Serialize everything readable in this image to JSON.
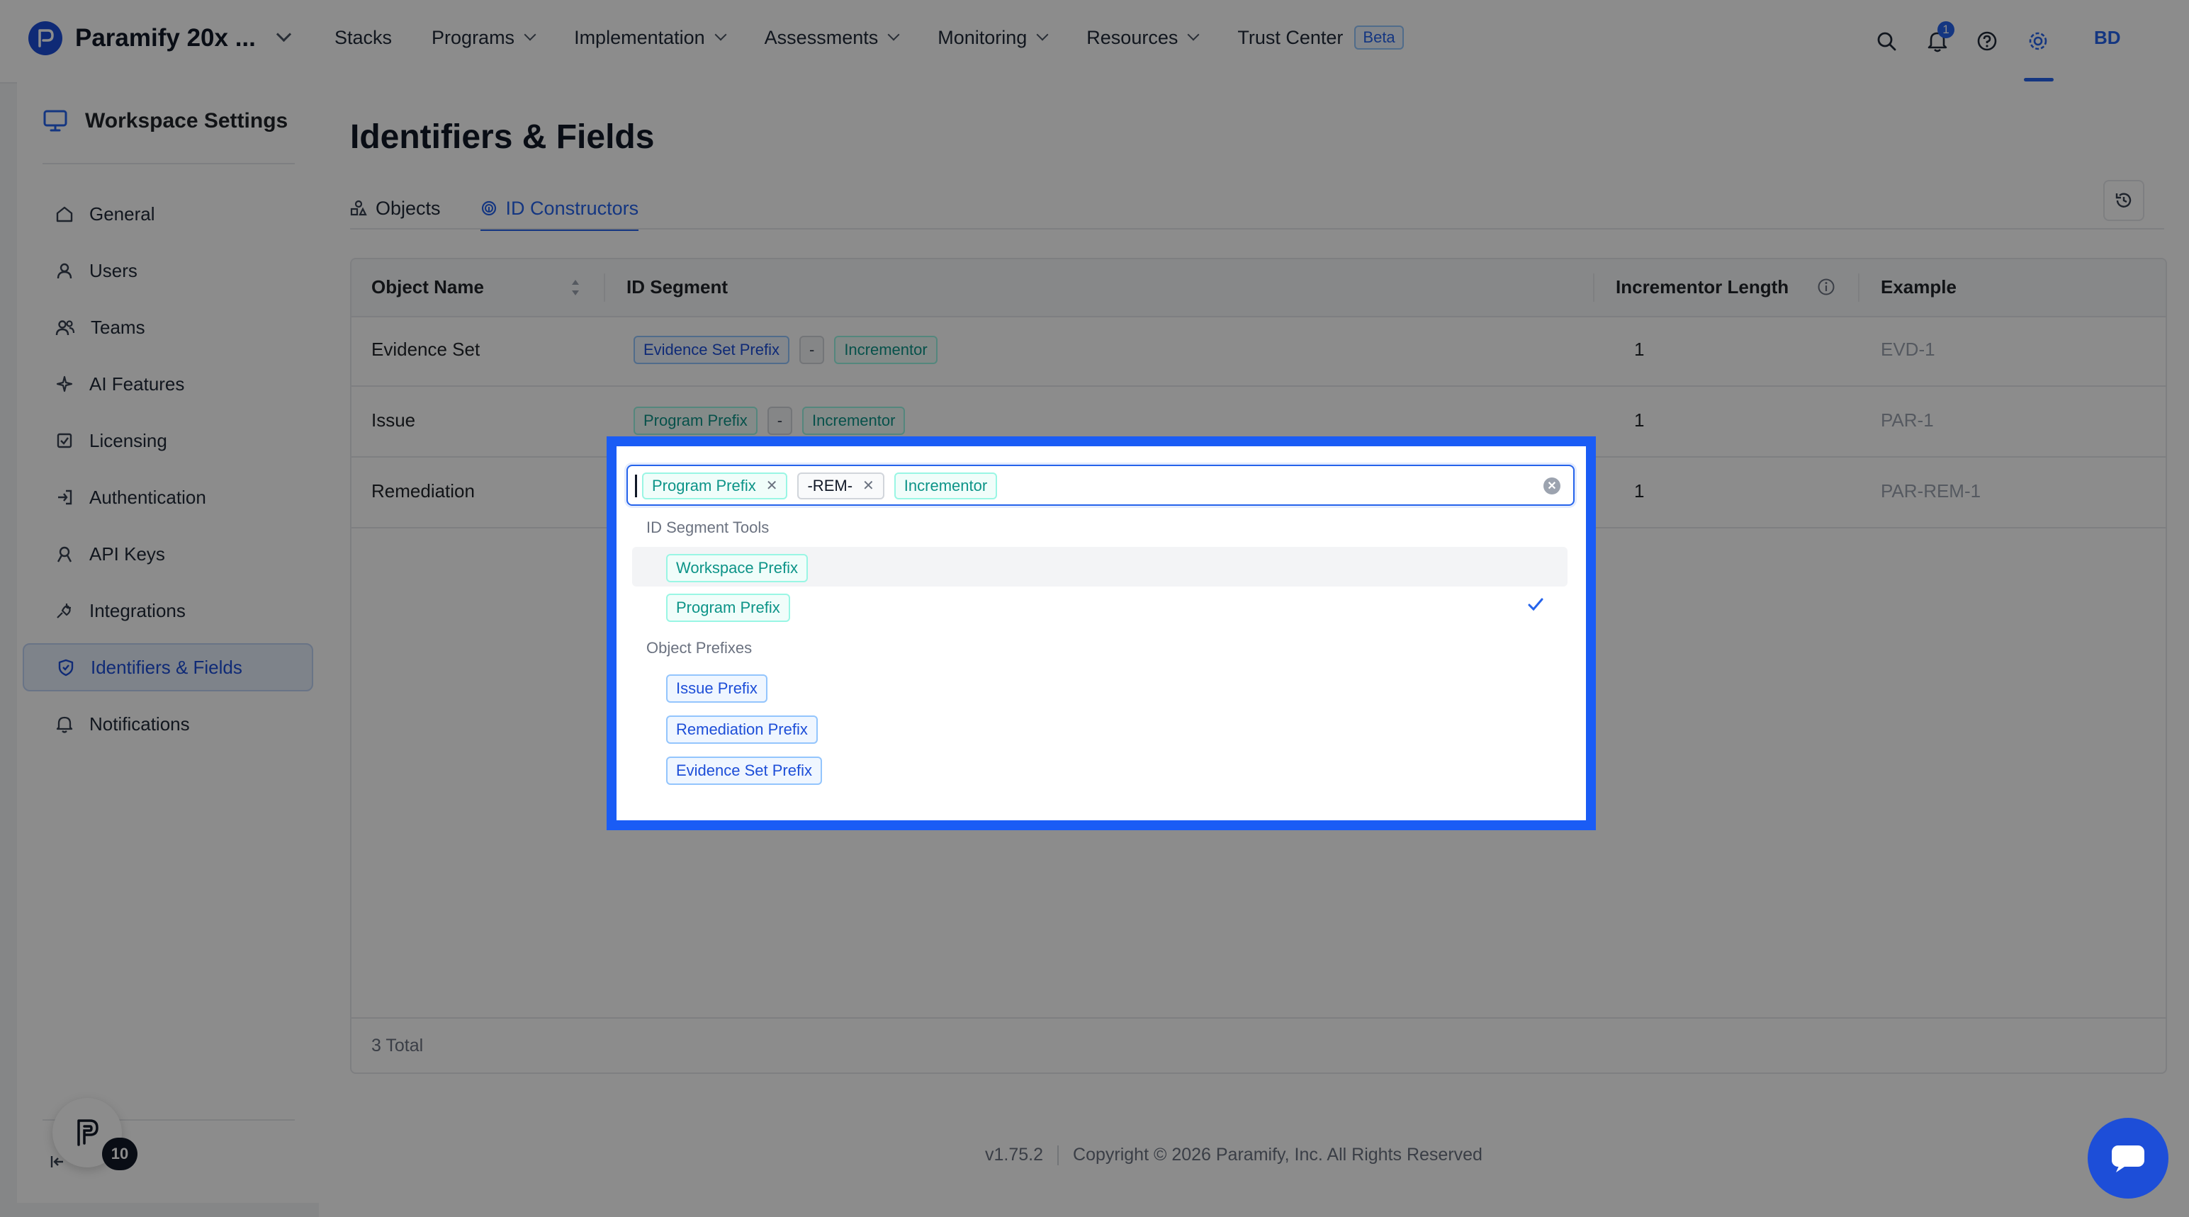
{
  "topbar": {
    "brand_name": "Paramify 20x ...",
    "nav": [
      {
        "label": "Stacks"
      },
      {
        "label": "Programs"
      },
      {
        "label": "Implementation"
      },
      {
        "label": "Assessments"
      },
      {
        "label": "Monitoring"
      },
      {
        "label": "Resources"
      },
      {
        "label": "Trust Center"
      }
    ],
    "trust_center_badge": "Beta",
    "notification_count": "1",
    "avatar_initials": "BD",
    "icons": [
      "search-icon",
      "bell-icon",
      "help-circle-icon",
      "gear-icon"
    ]
  },
  "sidebar": {
    "title": "Workspace Settings",
    "items": [
      {
        "label": "General",
        "icon": "home-icon"
      },
      {
        "label": "Users",
        "icon": "user-icon"
      },
      {
        "label": "Teams",
        "icon": "team-icon"
      },
      {
        "label": "AI Features",
        "icon": "sparkle-icon"
      },
      {
        "label": "Licensing",
        "icon": "license-icon"
      },
      {
        "label": "Authentication",
        "icon": "login-icon"
      },
      {
        "label": "API Keys",
        "icon": "api-icon"
      },
      {
        "label": "Integrations",
        "icon": "plug-icon"
      },
      {
        "label": "Identifiers & Fields",
        "icon": "shield-check-icon"
      },
      {
        "label": "Notifications",
        "icon": "bell-icon"
      }
    ],
    "active_index": 8,
    "helper_count": "10"
  },
  "main": {
    "title": "Identifiers & Fields",
    "tabs": [
      {
        "label": "Objects"
      },
      {
        "label": "ID Constructors"
      }
    ],
    "active_tab": 1,
    "table": {
      "columns": [
        "Object Name",
        "ID Segment",
        "Incrementor Length",
        "Example"
      ],
      "rows": [
        {
          "name": "Evidence Set",
          "segments": [
            "Evidence Set Prefix",
            "-",
            "Incrementor"
          ],
          "length": "1",
          "example": "EVD-1"
        },
        {
          "name": "Issue",
          "segments": [
            "Program Prefix",
            "-",
            "Incrementor"
          ],
          "length": "1",
          "example": "PAR-1"
        },
        {
          "name": "Remediation",
          "segments": [],
          "length": "1",
          "example": "PAR-REM-1"
        }
      ],
      "total": "3 Total"
    }
  },
  "dropdown": {
    "selected": [
      "Program Prefix",
      "-REM-",
      "Incrementor"
    ],
    "groups": [
      {
        "label": "ID Segment Tools",
        "options": [
          "Workspace Prefix",
          "Program Prefix"
        ]
      },
      {
        "label": "Object Prefixes",
        "options": [
          "Issue Prefix",
          "Remediation Prefix",
          "Evidence Set Prefix"
        ]
      }
    ],
    "checked_option": "Program Prefix"
  },
  "footer": {
    "version": "v1.75.2",
    "copyright": "Copyright © 2026 Paramify, Inc. All Rights Reserved"
  },
  "colors": {
    "accent": "#2563eb",
    "focus_frame": "#1a5cf5",
    "teal_chip": "#0d9488"
  }
}
